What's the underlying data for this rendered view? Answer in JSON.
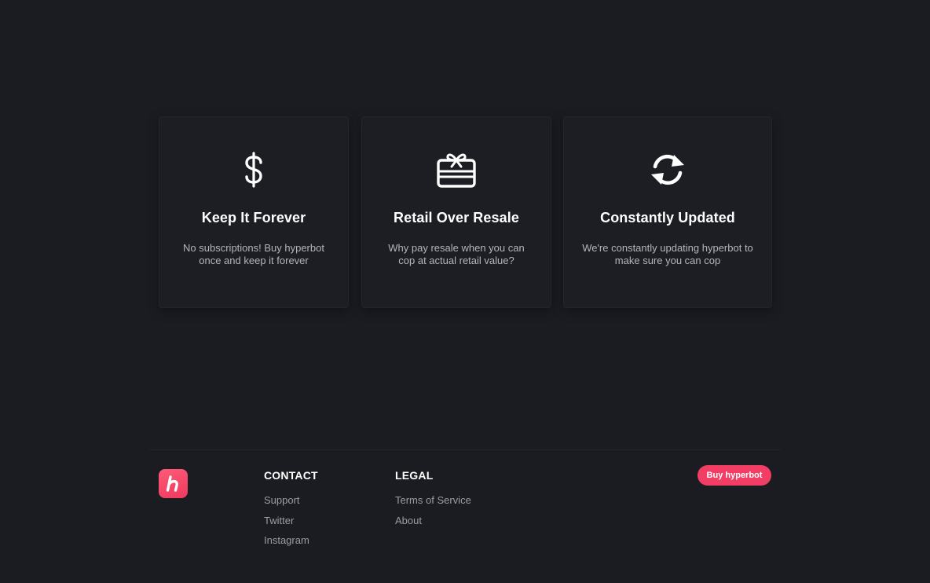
{
  "features": [
    {
      "icon": "dollar-icon",
      "title": "Keep It Forever",
      "description": "No subscriptions! Buy hyperbot once and keep it forever"
    },
    {
      "icon": "gift-card-icon",
      "title": "Retail Over Resale",
      "description": "Why pay resale when you can cop at actual retail value?"
    },
    {
      "icon": "refresh-icon",
      "title": "Constantly Updated",
      "description": "We're constantly updating hyperbot to make sure you can cop"
    }
  ],
  "footer": {
    "logo_icon": "hyperbot-logo-icon",
    "contact": {
      "heading": "CONTACT",
      "links": [
        "Support",
        "Twitter",
        "Instagram"
      ]
    },
    "legal": {
      "heading": "LEGAL",
      "links": [
        "Terms of Service",
        "About"
      ]
    },
    "buy_button": "Buy hyperbot"
  },
  "colors": {
    "background": "#1b1c22",
    "card": "#1d1e24",
    "accent": "#f23e64",
    "muted_text": "#9c9da3"
  }
}
